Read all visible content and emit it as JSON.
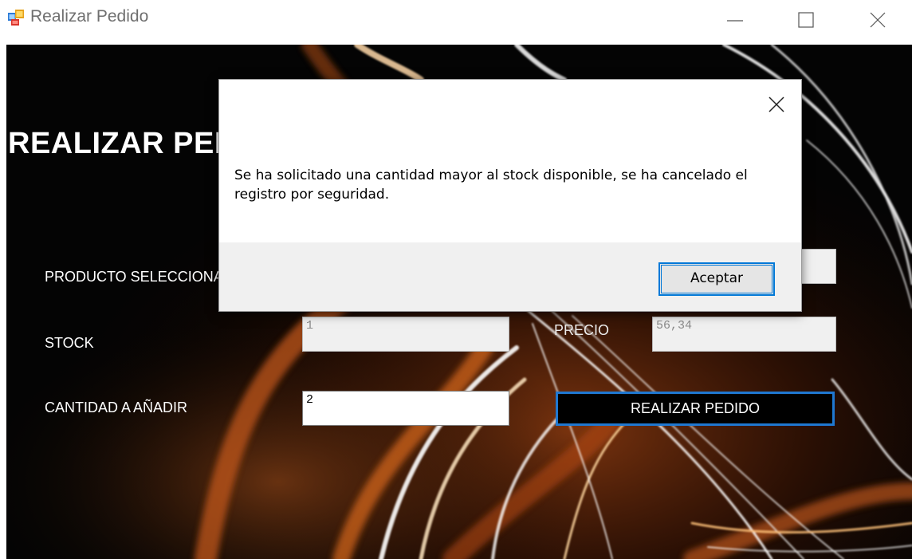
{
  "window": {
    "title": "Realizar Pedido",
    "icon": "windows-forms-app-icon",
    "controls": [
      "minimize-icon",
      "maximize-icon",
      "close-icon"
    ]
  },
  "form": {
    "heading": "REALIZAR PEDIDO",
    "fields": {
      "producto": {
        "label": "PRODUCTO SELECCIONADO",
        "value": ""
      },
      "stock": {
        "label": "STOCK",
        "value": "1"
      },
      "precio": {
        "label": "PRECIO",
        "value": "56,34"
      },
      "cantidad": {
        "label": "CANTIDAD A AÑADIR",
        "value": "2"
      }
    },
    "submit_label": "REALIZAR PEDIDO"
  },
  "dialog": {
    "message": "Se ha solicitado una cantidad mayor al stock disponible, se ha cancelado el registro por seguridad.",
    "ok_label": "Aceptar",
    "close_icon": "close-icon"
  },
  "colors": {
    "accent": "#0078d7",
    "submit_border": "#1f78d1",
    "background": "#050505"
  }
}
